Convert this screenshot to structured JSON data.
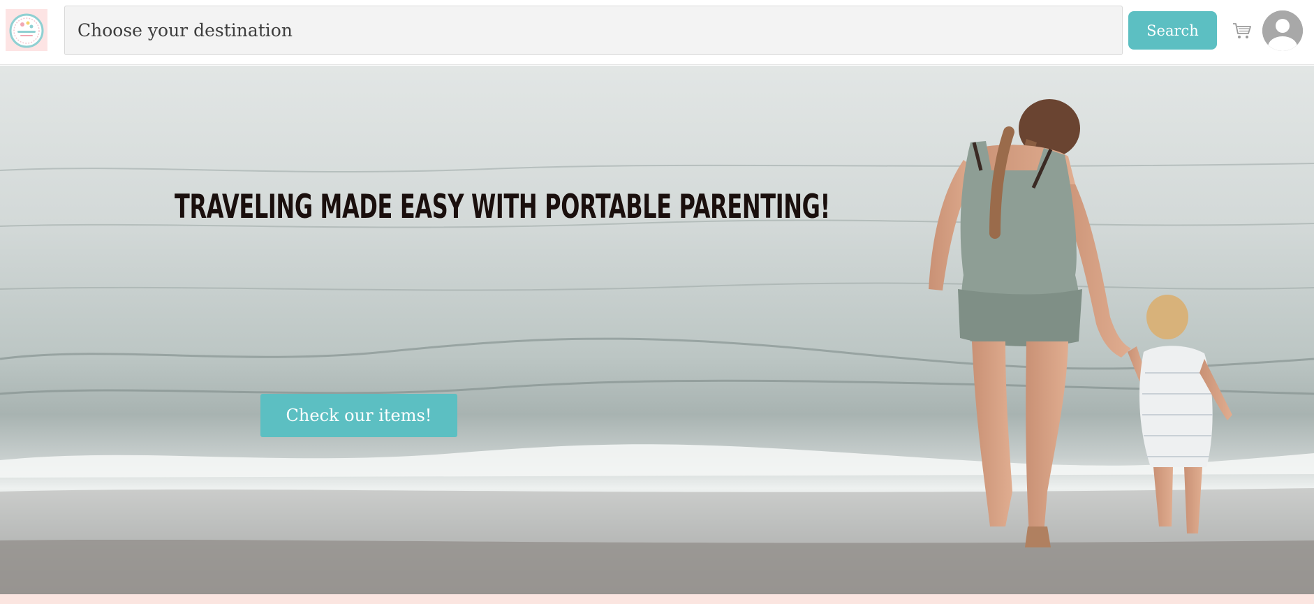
{
  "header": {
    "search": {
      "placeholder": "Choose your destination",
      "value": ""
    },
    "search_button_label": "Search",
    "icons": {
      "logo": "portable-parenting-logo",
      "cart": "cart-icon",
      "avatar": "user-avatar-icon"
    }
  },
  "hero": {
    "title": "TRAVELING MADE EASY WITH PORTABLE PARENTING!",
    "cta_label": "Check our items!",
    "image": "mother-and-toddler-walking-on-beach"
  },
  "colors": {
    "accent": "#5cbfc2",
    "footer_strip": "#fbe5e0",
    "logo_bg": "#fde4e4",
    "title_text": "#1a0f0d"
  }
}
